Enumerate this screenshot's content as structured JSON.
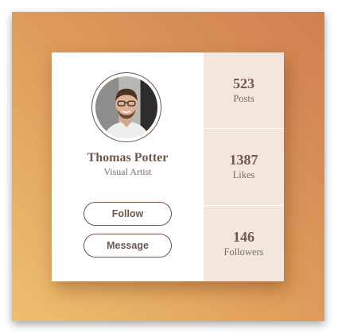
{
  "profile": {
    "name": "Thomas Potter",
    "role": "Visual Artist",
    "follow_label": "Follow",
    "message_label": "Message"
  },
  "stats": [
    {
      "value": "523",
      "label": "Posts"
    },
    {
      "value": "1387",
      "label": "Likes"
    },
    {
      "value": "146",
      "label": "Followers"
    }
  ],
  "colors": {
    "gradient_start": "#edbf6e",
    "gradient_end": "#cf8050",
    "stats_panel": "#f5e6dd",
    "text": "#6b5a4f"
  }
}
